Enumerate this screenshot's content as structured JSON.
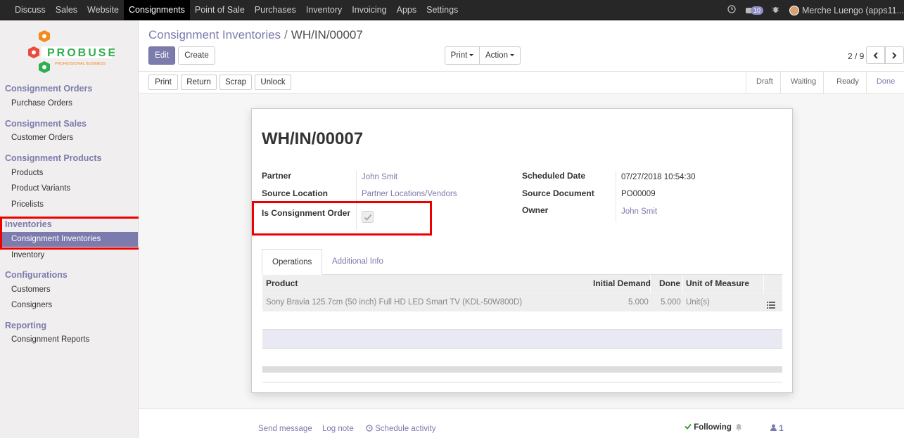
{
  "topbar": {
    "menu": [
      "Discuss",
      "Sales",
      "Website",
      "Consignments",
      "Point of Sale",
      "Purchases",
      "Inventory",
      "Invoicing",
      "Apps",
      "Settings"
    ],
    "active_menu": "Consignments",
    "message_count": "10",
    "user": "Merche Luengo (apps11..."
  },
  "logo": {
    "text": "PROBUSE",
    "tagline": "PROFESSIONAL BUSINESS"
  },
  "sidebar": {
    "sections": [
      {
        "title": "Consignment Orders",
        "items": [
          "Purchase Orders"
        ]
      },
      {
        "title": "Consignment Sales",
        "items": [
          "Customer Orders"
        ]
      },
      {
        "title": "Consignment Products",
        "items": [
          "Products",
          "Product Variants",
          "Pricelists"
        ]
      },
      {
        "title": "Inventories",
        "items": [
          "Consignment Inventories",
          "Inventory"
        ]
      },
      {
        "title": "Configurations",
        "items": [
          "Customers",
          "Consigners"
        ]
      },
      {
        "title": "Reporting",
        "items": [
          "Consignment Reports"
        ]
      }
    ],
    "active_item": "Consignment Inventories"
  },
  "breadcrumb": {
    "parent": "Consignment Inventories",
    "separator": "/",
    "current": "WH/IN/00007"
  },
  "buttons": {
    "edit": "Edit",
    "create": "Create",
    "print_menu": "Print",
    "action_menu": "Action"
  },
  "pager": {
    "value": "2 / 9"
  },
  "header_buttons": {
    "print": "Print",
    "return": "Return",
    "scrap": "Scrap",
    "unlock": "Unlock"
  },
  "stages": [
    "Draft",
    "Waiting",
    "Ready",
    "Done"
  ],
  "current_stage": "Done",
  "record": {
    "name": "WH/IN/00007",
    "partner_label": "Partner",
    "partner": "John Smit",
    "source_location_label": "Source Location",
    "source_location": "Partner Locations/Vendors",
    "consignment_label": "Is Consignment Order",
    "is_consignment": true,
    "scheduled_date_label": "Scheduled Date",
    "scheduled_date": "07/27/2018 10:54:30",
    "source_document_label": "Source Document",
    "source_document": "PO00009",
    "owner_label": "Owner",
    "owner": "John Smit"
  },
  "tabs": [
    "Operations",
    "Additional Info"
  ],
  "table": {
    "headers": [
      "Product",
      "Initial Demand",
      "Done",
      "Unit of Measure"
    ],
    "rows": [
      {
        "product": "Sony Bravia 125.7cm (50 inch) Full HD LED Smart TV (KDL-50W800D)",
        "initial_demand": "5.000",
        "done": "5.000",
        "uom": "Unit(s)"
      }
    ]
  },
  "chatter": {
    "send_message": "Send message",
    "log_note": "Log note",
    "schedule_activity": "Schedule activity",
    "following": "Following",
    "followers": "1"
  },
  "colors": {
    "accent": "#7c7bad",
    "highlight": "#e00000",
    "topbar": "#272727"
  }
}
